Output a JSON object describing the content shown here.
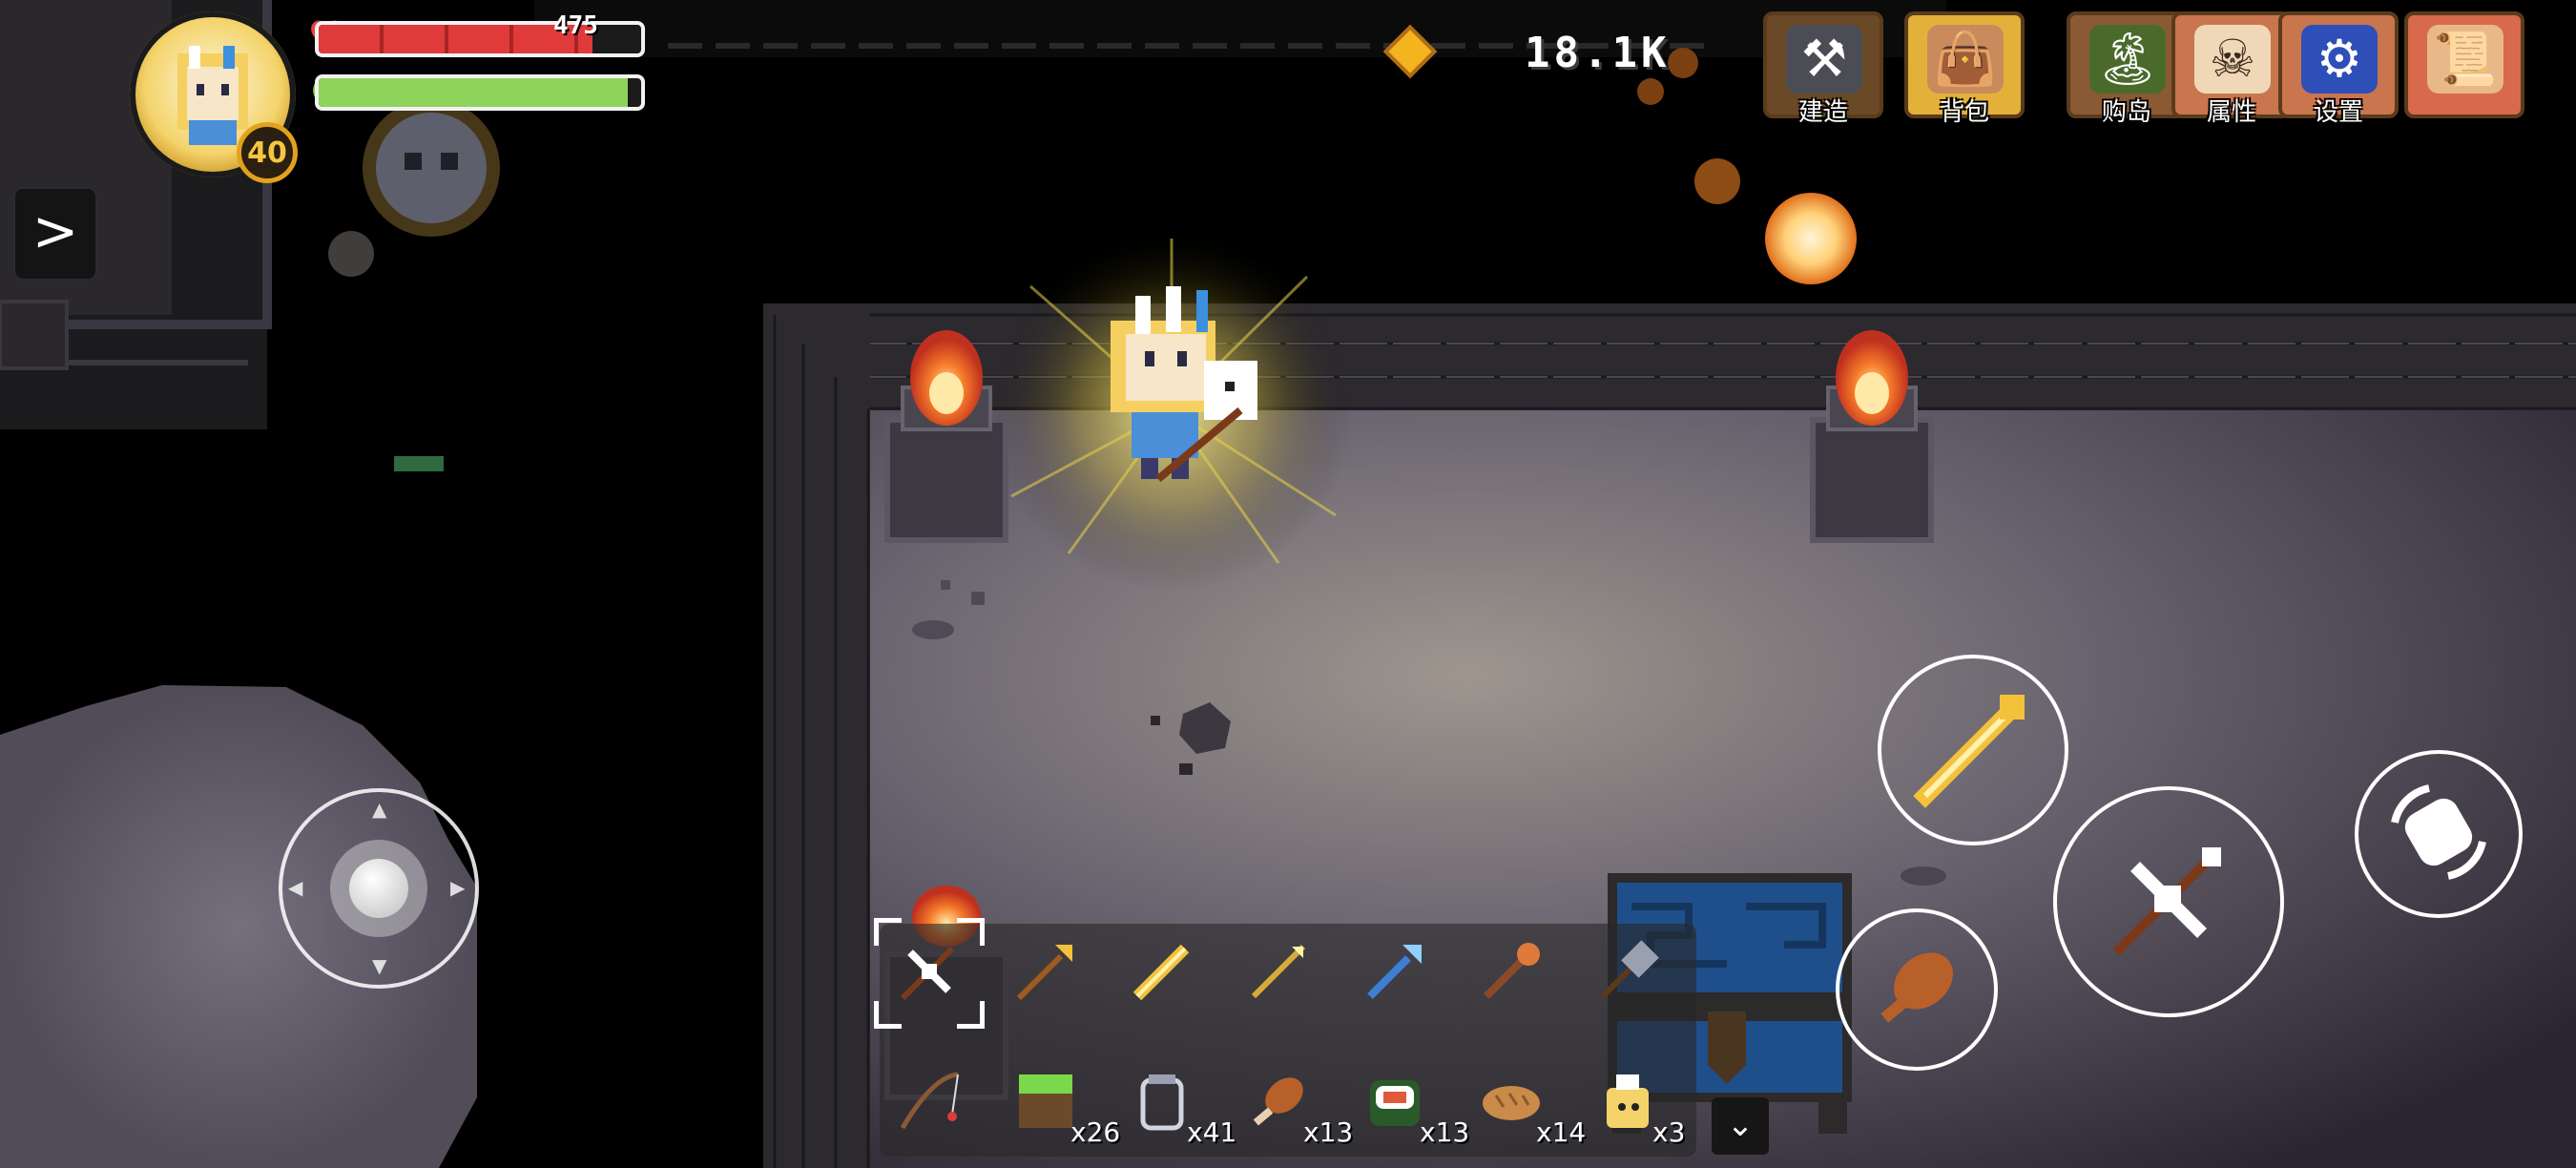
{
  "hud": {
    "hp_text": "475",
    "hp_fraction": 0.85,
    "mp_fraction": 0.96,
    "level": "40",
    "heart_icon": "heart-icon",
    "mana_icon": "mana-drop-icon",
    "side_toggle_glyph": ">"
  },
  "currency": {
    "value": "18.1K",
    "icon": "gem-icon"
  },
  "menu": {
    "build": "建造",
    "backpack": "背包",
    "buy_island": "购岛",
    "attributes": "属性",
    "settings": "设置"
  },
  "hotbar": {
    "weapons": [
      {
        "name": "crossbow",
        "selected": true
      },
      {
        "name": "golden-spear"
      },
      {
        "name": "golden-sword"
      },
      {
        "name": "golden-lance"
      },
      {
        "name": "ice-trident"
      },
      {
        "name": "fire-staff"
      },
      {
        "name": "war-hammer"
      }
    ],
    "items": [
      {
        "name": "fishing-rod",
        "count": ""
      },
      {
        "name": "grass-block",
        "count": "x26"
      },
      {
        "name": "glass-jar",
        "count": "x41"
      },
      {
        "name": "roast-meat",
        "count": "x13"
      },
      {
        "name": "sushi",
        "count": "x13"
      },
      {
        "name": "bread",
        "count": "x14"
      },
      {
        "name": "potion",
        "count": "x3"
      }
    ],
    "expand_glyph": "⌄"
  },
  "colors": {
    "hp": "#e03a3a",
    "mp": "#8ed35a",
    "gold": "#f3b420"
  }
}
